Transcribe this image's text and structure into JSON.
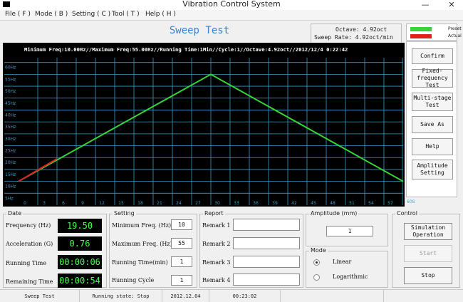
{
  "window": {
    "title": "Vibration Control System",
    "minimize": "—",
    "close": "✕",
    "icon": "app-icon"
  },
  "menu": [
    "File ( F )",
    "Mode ( B )",
    "Setting ( C )",
    "Tool ( T )",
    "Help ( H )"
  ],
  "sweep_title": "Sweep Test",
  "info": {
    "octave": "Octave: 4.92oct",
    "sweep_rate": "Sweep Rate: 4.92oct/min"
  },
  "legend": [
    {
      "label": "Preset",
      "color": "#3ad13a"
    },
    {
      "label": "Actual",
      "color": "#e02020"
    }
  ],
  "chart_header": "Minimum Freq:10.00Hz//Maximum Freq:55.00Hz//Running Time:1Min//Cycle:1//Octave:4.92oct//2012/12/4 0:22:42",
  "chart_data": {
    "type": "line",
    "x_ticks": [
      "0",
      "3",
      "6",
      "9",
      "12",
      "15",
      "18",
      "21",
      "24",
      "27",
      "30",
      "33",
      "36",
      "39",
      "42",
      "45",
      "48",
      "51",
      "54",
      "57"
    ],
    "x_unit": "60S",
    "y_ticks": [
      "5Hz",
      "10Hz",
      "15Hz",
      "20Hz",
      "25Hz",
      "30Hz",
      "35Hz",
      "40Hz",
      "45Hz",
      "50Hz",
      "55Hz",
      "60Hz"
    ],
    "xlim": [
      0,
      60
    ],
    "ylim": [
      0,
      62
    ],
    "grid": true,
    "series": [
      {
        "name": "Preset",
        "color": "#3ad13a",
        "x": [
          0,
          30,
          60
        ],
        "y": [
          10,
          55,
          10
        ]
      },
      {
        "name": "Actual",
        "color": "#e02020",
        "x": [
          0,
          6
        ],
        "y": [
          10,
          19.5
        ]
      }
    ]
  },
  "right_buttons": [
    "Confirm",
    "Fixed-frequency Test",
    "Multi-stage Test",
    "Save As",
    "Help",
    "Amplitude Setting"
  ],
  "date_panel": {
    "title": "Date",
    "rows": [
      {
        "label": "Frequency (Hz)",
        "value": "19.50"
      },
      {
        "label": "Acceleration (G)",
        "value": "0.76"
      },
      {
        "label": "Running Time",
        "value": "00:00:06"
      },
      {
        "label": "Remaining Time",
        "value": "00:00:54"
      }
    ]
  },
  "setting_panel": {
    "title": "Setting",
    "rows": [
      {
        "label": "Minimum Freq. (Hz)",
        "value": "10"
      },
      {
        "label": "Maximum Freq. (Hz)",
        "value": "55"
      },
      {
        "label": "Running Time(min)",
        "value": "1"
      },
      {
        "label": "Running Cycle",
        "value": "1"
      }
    ]
  },
  "report_panel": {
    "title": "Report",
    "rows": [
      {
        "label": "Remark 1",
        "value": ""
      },
      {
        "label": "Remark 2",
        "value": ""
      },
      {
        "label": "Remark 3",
        "value": ""
      },
      {
        "label": "Remark 4",
        "value": ""
      }
    ]
  },
  "amplitude_panel": {
    "title": "Amplitude (mm)",
    "value": "1"
  },
  "mode_panel": {
    "title": "Mode",
    "options": [
      "Linear",
      "Logarithmic"
    ],
    "selected": "Linear"
  },
  "control_panel": {
    "title": "Control",
    "buttons": [
      "Simulation Operation",
      "Start",
      "Stop"
    ]
  },
  "status_bar": [
    "Sweep Test",
    "Running state: Stop",
    "2012.12.04",
    "00:23:02"
  ]
}
